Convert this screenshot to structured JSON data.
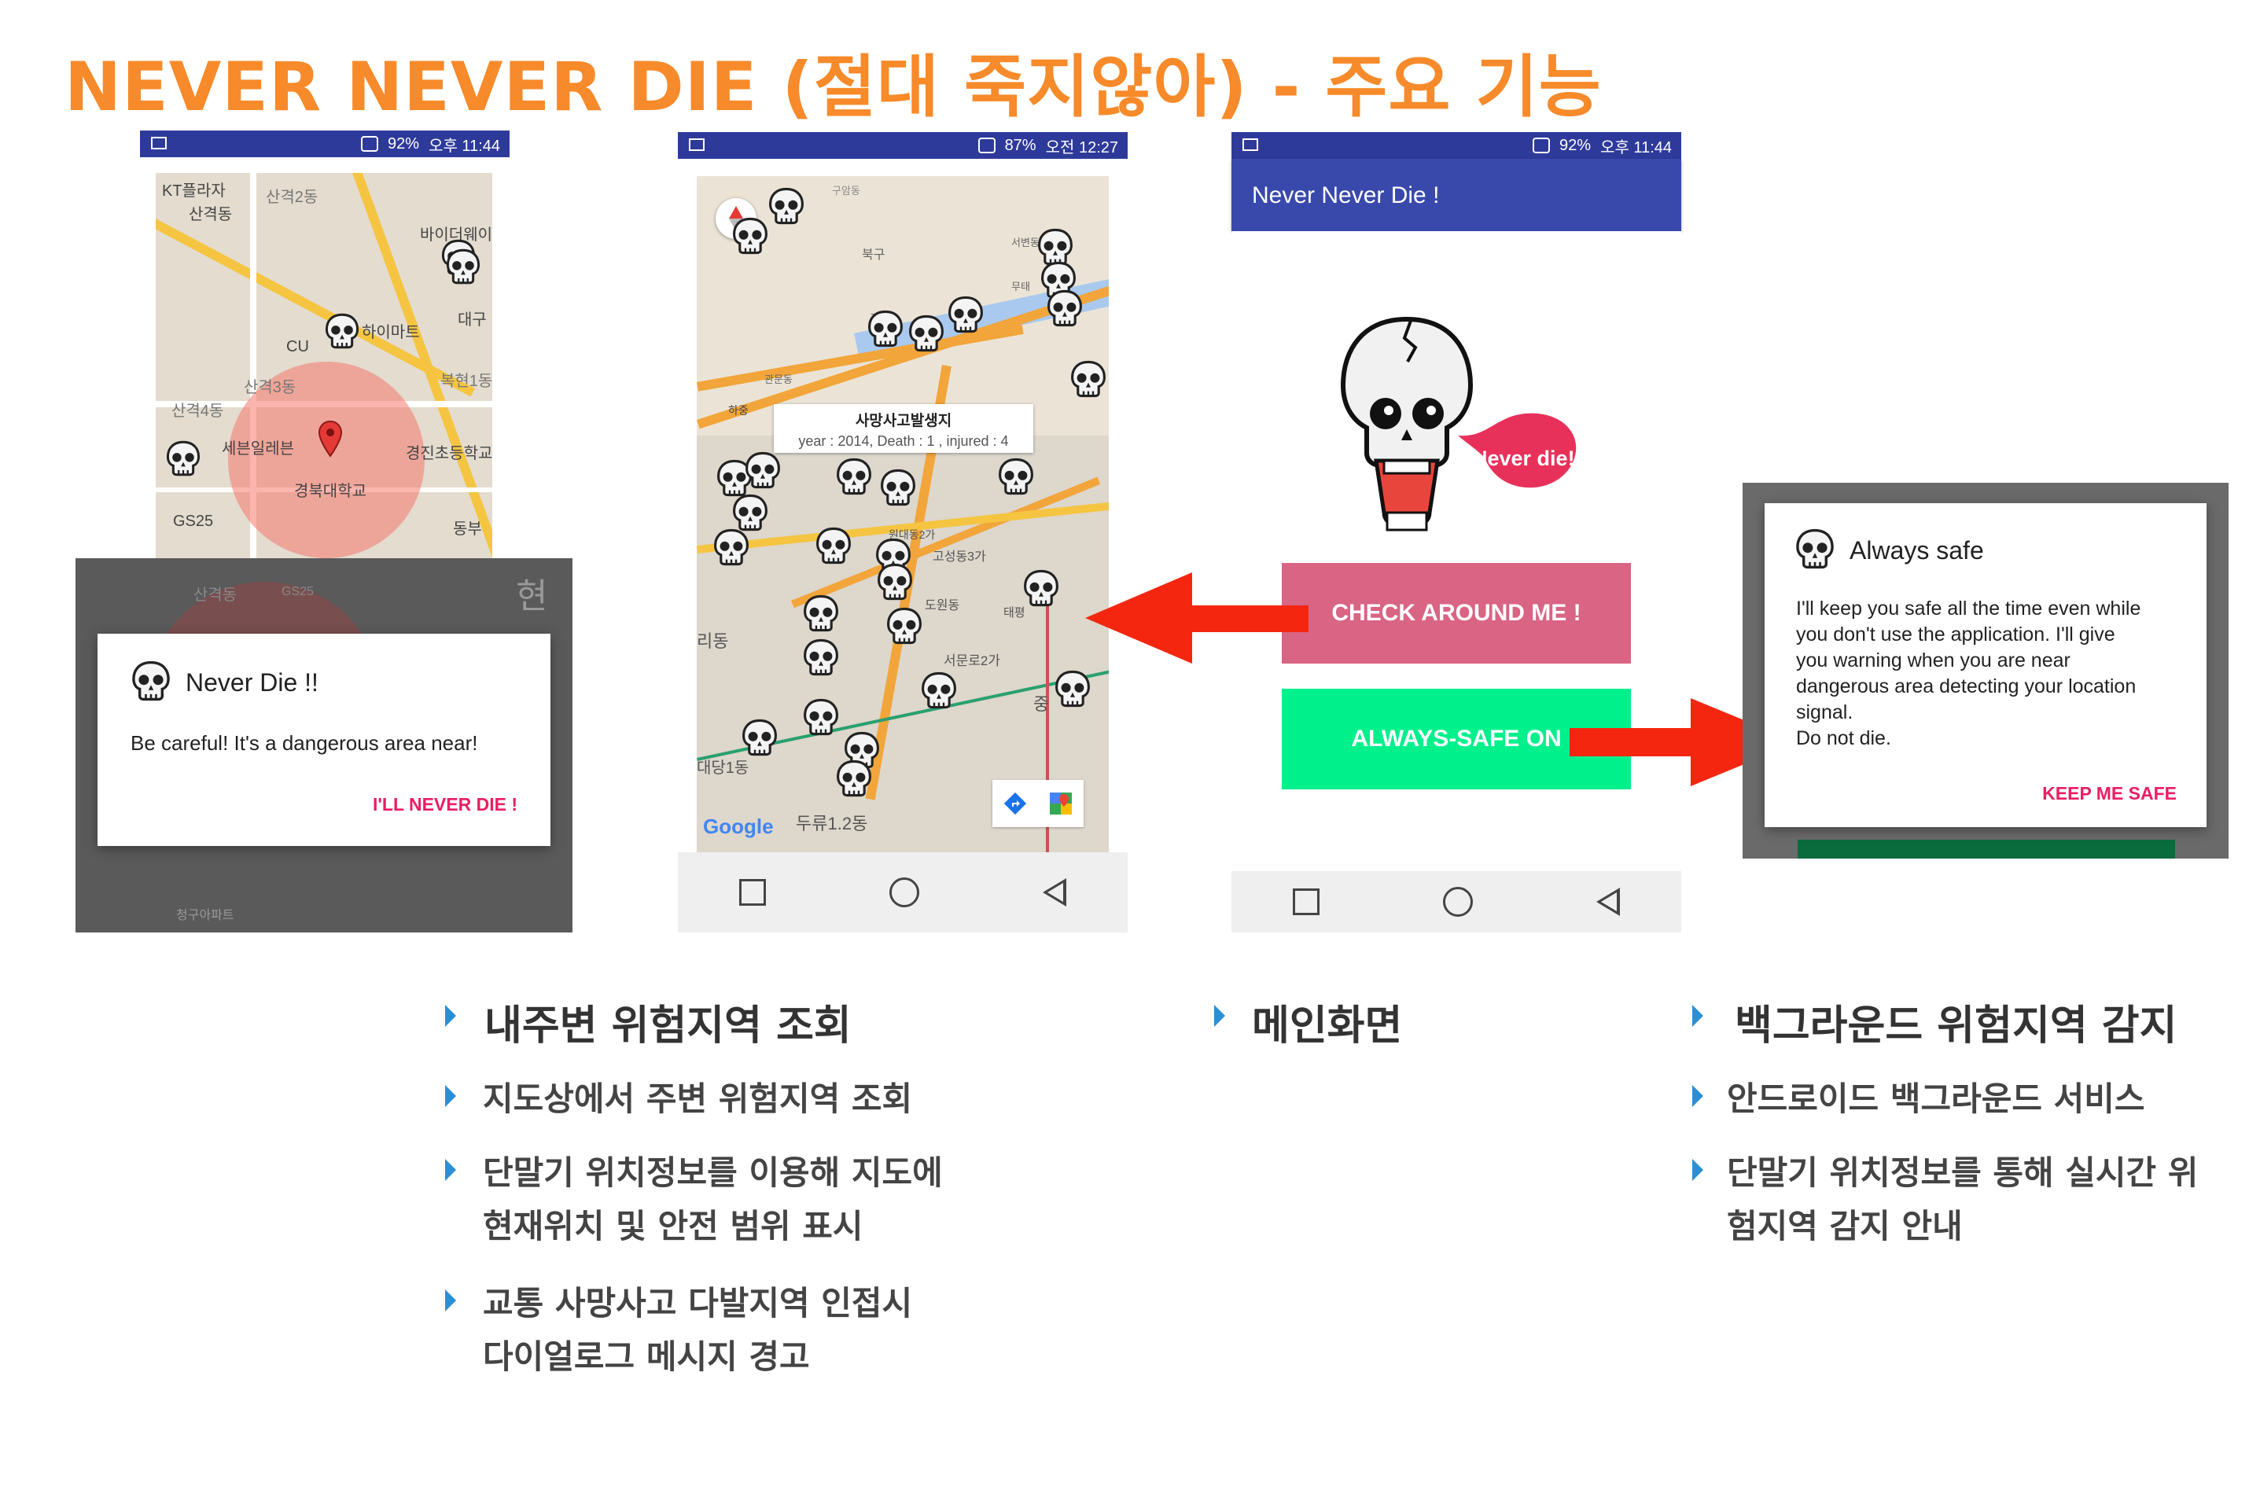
{
  "title": "NEVER NEVER DIE (절대 죽지않아) - 주요 기능",
  "phone1": {
    "status": {
      "battery": "92%",
      "time": "오후 11:44"
    },
    "map_labels": [
      "KT플라자",
      "산격2동",
      "산격동",
      "바이더웨이",
      "하이마트",
      "대구",
      "CU",
      "산격3동",
      "복현1동",
      "산격4동",
      "세븐일레븐",
      "경진초등학교",
      "경북대학교",
      "GS25",
      "동부",
      "산격동",
      "GS25",
      "청구아파트",
      "현"
    ],
    "dialog": {
      "title": "Never Die !!",
      "message": "Be careful! It's a dangerous area near!",
      "action": "I'LL NEVER DIE !"
    }
  },
  "phone2": {
    "status": {
      "battery": "87%",
      "time": "오전 12:27"
    },
    "map_labels": [
      "북구",
      "구암동",
      "서변동",
      "무태",
      "조야동",
      "관문동",
      "하중",
      "원대동2가",
      "고성동3가",
      "태평",
      "도원동",
      "리동",
      "서문로2가",
      "중",
      "대당1동",
      "두류1.2동"
    ],
    "popup": {
      "title": "사망사고발생지",
      "detail": "year : 2014, Death : 1 , injured : 4"
    },
    "google": "Google"
  },
  "phone3": {
    "status": {
      "battery": "92%",
      "time": "오후 11:44"
    },
    "appbar_title": "Never Never Die !",
    "speech": "Never die!",
    "check_button": "CHECK AROUND ME !",
    "safe_button": "ALWAYS-SAFE ON"
  },
  "always_safe_dialog": {
    "title": "Always safe",
    "lines": [
      "I'll keep you safe all the time even while",
      "you don't use the application. I'll give",
      "you warning when you are near",
      "dangerous area detecting your location",
      "signal.",
      "Do not die."
    ],
    "action": "KEEP ME SAFE"
  },
  "sections": {
    "left": {
      "heading": "내주변 위험지역 조회",
      "items": [
        [
          "지도상에서 주변 위험지역 조회"
        ],
        [
          "단말기 위치정보를 이용해 지도에",
          "현재위치 및 안전 범위 표시"
        ],
        [
          "교통 사망사고 다발지역 인접시",
          "다이얼로그 메시지 경고"
        ]
      ]
    },
    "middle": {
      "heading": "메인화면"
    },
    "right": {
      "heading": "백그라운드 위험지역 감지",
      "items": [
        [
          "안드로이드 백그라운드 서비스"
        ],
        [
          "단말기 위치정보를 통해 실시간 위",
          "험지역 감지 안내"
        ]
      ]
    }
  },
  "colors": {
    "title": "#f78a2a",
    "statusbar": "#2e3a9a",
    "appbar": "#3949ab",
    "check": "#d96484",
    "safe": "#00f08c",
    "arrow": "#f4260f",
    "accent": "#e91e63",
    "bullet": "#2b8fd6"
  }
}
